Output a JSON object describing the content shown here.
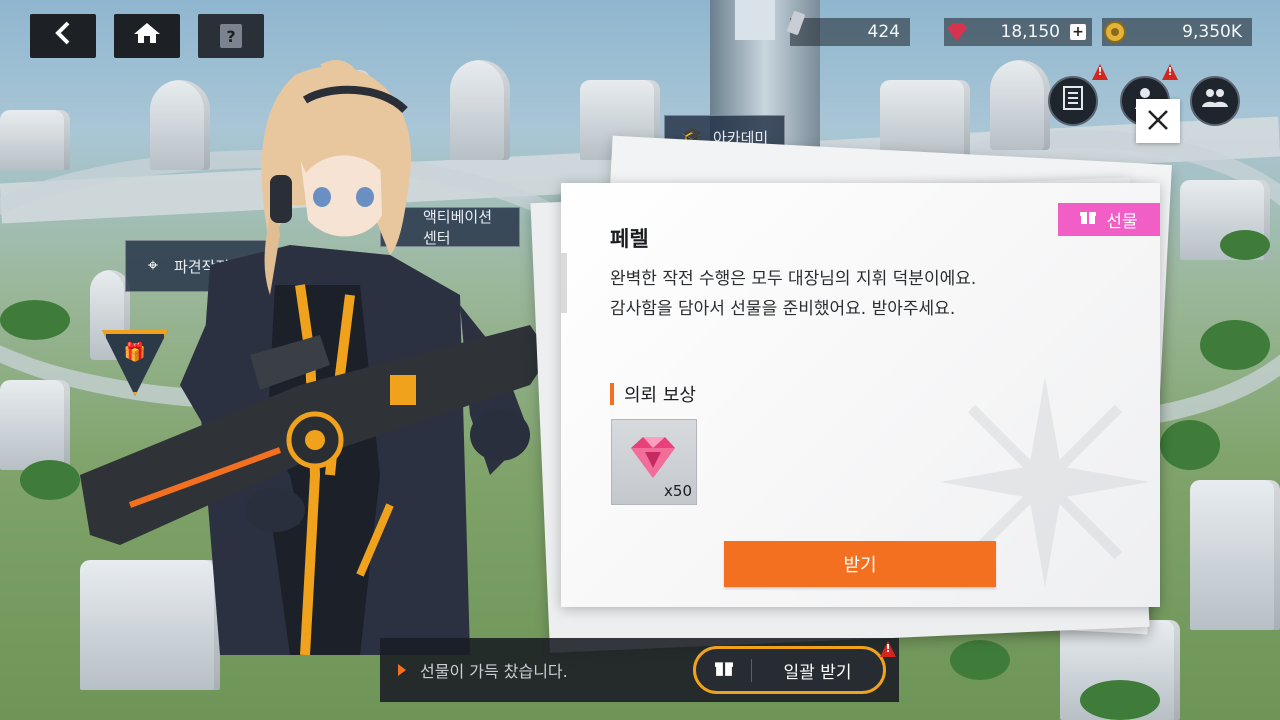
{
  "map": {
    "labels": [
      {
        "name": "academy",
        "text": "아카데미"
      },
      {
        "name": "activation-center",
        "text": "액티베이션 센터"
      },
      {
        "name": "dispatch-operation",
        "text": "파견작전실"
      }
    ]
  },
  "topbar": {
    "back_icon": "back-arrow-icon",
    "home_icon": "home-icon",
    "help_label": "?",
    "currencies": [
      {
        "name": "stamina",
        "value": "424",
        "icon": "ticket-icon"
      },
      {
        "name": "gem",
        "value": "18,150",
        "icon": "red-gem-icon",
        "plus": "+"
      },
      {
        "name": "gold",
        "value": "9,350K",
        "icon": "gold-coin-icon"
      }
    ],
    "alerts": [
      "!",
      "!",
      "!"
    ]
  },
  "dialog": {
    "tag": "선물",
    "speaker": "페렐",
    "message_lines": [
      "완벽한 작전 수행은 모두 대장님의 지휘 덕분이에요.",
      "감사함을 담아서 선물을 준비했어요. 받아주세요."
    ],
    "reward_title": "의뢰 보상",
    "reward_qty": "x50",
    "receive_label": "받기"
  },
  "bottom": {
    "status": "선물이 가득 찼습니다.",
    "bulk_label": "일괄 받기"
  },
  "colors": {
    "accent_orange": "#f37021",
    "gift_pink": "#f15fc6",
    "alert_red": "#d4261f",
    "gold_border": "#f1a21c"
  }
}
